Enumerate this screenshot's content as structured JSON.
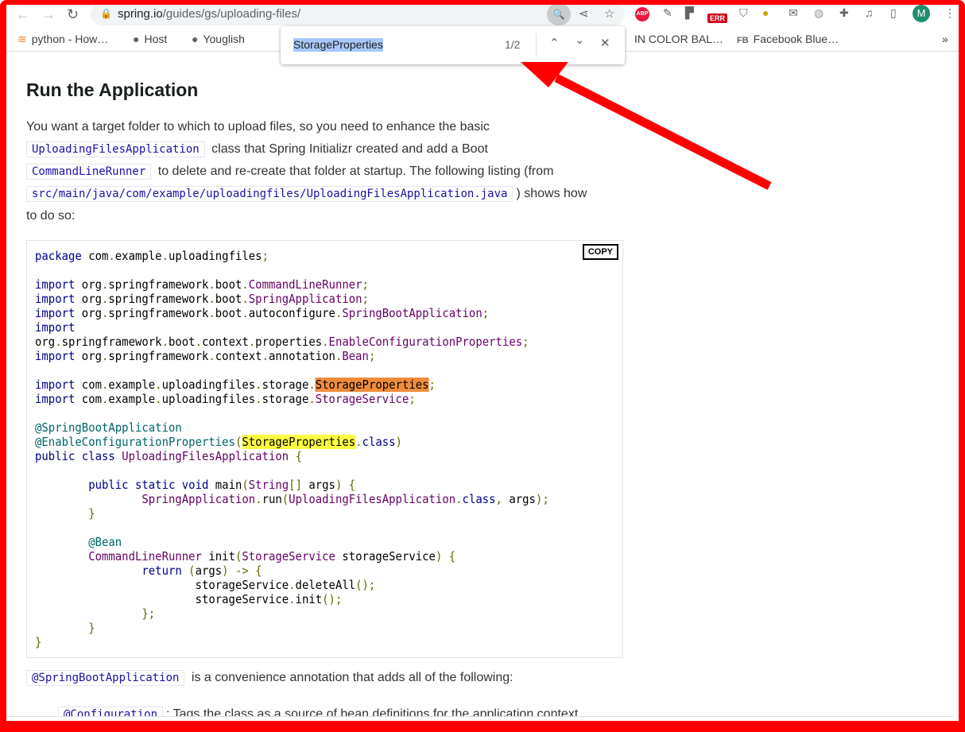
{
  "browser": {
    "url_domain": "spring.io",
    "url_path": "/guides/gs/uploading-files/",
    "profile_initial": "M",
    "extensions": {
      "abp": "ABP",
      "err": "ERR"
    },
    "bookmarks": [
      "python - How…",
      "Host",
      "Youglish",
      "IN COLOR BAL…",
      "Facebook Blue…"
    ],
    "fb_badge": "FB",
    "more": "»"
  },
  "findbar": {
    "query": "StorageProperties",
    "count": "1/2"
  },
  "page": {
    "heading": "Run the Application",
    "para_lines": [
      [
        {
          "t": "You want a target folder to which to upload files, so you need to enhance the basic"
        }
      ],
      [
        {
          "c": "UploadingFilesApplication"
        },
        {
          "t": " class that Spring Initializr created and add a Boot"
        }
      ],
      [
        {
          "c": "CommandLineRunner"
        },
        {
          "t": " to delete and re-create that folder at startup. The following listing (from"
        }
      ],
      [
        {
          "c": "src/main/java/com/example/uploadingfiles/UploadingFilesApplication.java"
        },
        {
          "t": ") shows how"
        }
      ],
      [
        {
          "t": "to do so:"
        }
      ]
    ],
    "copy_label": "COPY",
    "after_code": "@SpringBootApplication",
    "after_text": " is a convenience annotation that adds all of the following:",
    "list_code": "@Configuration",
    "list_text": ": Tags the class as a source of bean definitions for the application context."
  },
  "code": [
    [
      [
        "k",
        "package"
      ],
      [
        "x",
        " com"
      ],
      [
        "p",
        "."
      ],
      [
        "x",
        "example"
      ],
      [
        "p",
        "."
      ],
      [
        "x",
        "uploadingfiles"
      ],
      [
        "p",
        ";"
      ]
    ],
    [],
    [
      [
        "k",
        "import"
      ],
      [
        "x",
        " org"
      ],
      [
        "p",
        "."
      ],
      [
        "x",
        "springframework"
      ],
      [
        "p",
        "."
      ],
      [
        "x",
        "boot"
      ],
      [
        "p",
        "."
      ],
      [
        "t",
        "CommandLineRunner"
      ],
      [
        "p",
        ";"
      ]
    ],
    [
      [
        "k",
        "import"
      ],
      [
        "x",
        " org"
      ],
      [
        "p",
        "."
      ],
      [
        "x",
        "springframework"
      ],
      [
        "p",
        "."
      ],
      [
        "x",
        "boot"
      ],
      [
        "p",
        "."
      ],
      [
        "t",
        "SpringApplication"
      ],
      [
        "p",
        ";"
      ]
    ],
    [
      [
        "k",
        "import"
      ],
      [
        "x",
        " org"
      ],
      [
        "p",
        "."
      ],
      [
        "x",
        "springframework"
      ],
      [
        "p",
        "."
      ],
      [
        "x",
        "boot"
      ],
      [
        "p",
        "."
      ],
      [
        "x",
        "autoconfigure"
      ],
      [
        "p",
        "."
      ],
      [
        "t",
        "SpringBootApplication"
      ],
      [
        "p",
        ";"
      ]
    ],
    [
      [
        "k",
        "import"
      ]
    ],
    [
      [
        "x",
        "org"
      ],
      [
        "p",
        "."
      ],
      [
        "x",
        "springframework"
      ],
      [
        "p",
        "."
      ],
      [
        "x",
        "boot"
      ],
      [
        "p",
        "."
      ],
      [
        "x",
        "context"
      ],
      [
        "p",
        "."
      ],
      [
        "x",
        "properties"
      ],
      [
        "p",
        "."
      ],
      [
        "t",
        "EnableConfigurationProperties"
      ],
      [
        "p",
        ";"
      ]
    ],
    [
      [
        "k",
        "import"
      ],
      [
        "x",
        " org"
      ],
      [
        "p",
        "."
      ],
      [
        "x",
        "springframework"
      ],
      [
        "p",
        "."
      ],
      [
        "x",
        "context"
      ],
      [
        "p",
        "."
      ],
      [
        "x",
        "annotation"
      ],
      [
        "p",
        "."
      ],
      [
        "t",
        "Bean"
      ],
      [
        "p",
        ";"
      ]
    ],
    [],
    [
      [
        "k",
        "import"
      ],
      [
        "x",
        " com"
      ],
      [
        "p",
        "."
      ],
      [
        "x",
        "example"
      ],
      [
        "p",
        "."
      ],
      [
        "x",
        "uploadingfiles"
      ],
      [
        "p",
        "."
      ],
      [
        "x",
        "storage"
      ],
      [
        "p",
        "."
      ],
      [
        "h1",
        "StorageProperties"
      ],
      [
        "p",
        ";"
      ]
    ],
    [
      [
        "k",
        "import"
      ],
      [
        "x",
        " com"
      ],
      [
        "p",
        "."
      ],
      [
        "x",
        "example"
      ],
      [
        "p",
        "."
      ],
      [
        "x",
        "uploadingfiles"
      ],
      [
        "p",
        "."
      ],
      [
        "x",
        "storage"
      ],
      [
        "p",
        "."
      ],
      [
        "t",
        "StorageService"
      ],
      [
        "p",
        ";"
      ]
    ],
    [],
    [
      [
        "a",
        "@SpringBootApplication"
      ]
    ],
    [
      [
        "a",
        "@EnableConfigurationProperties"
      ],
      [
        "p",
        "("
      ],
      [
        "h2",
        "StorageProperties"
      ],
      [
        "p",
        "."
      ],
      [
        "k",
        "class"
      ],
      [
        "p",
        ")"
      ]
    ],
    [
      [
        "k",
        "public"
      ],
      [
        "x",
        " "
      ],
      [
        "k",
        "class"
      ],
      [
        "x",
        " "
      ],
      [
        "t",
        "UploadingFilesApplication"
      ],
      [
        "x",
        " "
      ],
      [
        "p",
        "{"
      ]
    ],
    [],
    [
      [
        "x",
        "        "
      ],
      [
        "k",
        "public"
      ],
      [
        "x",
        " "
      ],
      [
        "k",
        "static"
      ],
      [
        "x",
        " "
      ],
      [
        "k",
        "void"
      ],
      [
        "x",
        " main"
      ],
      [
        "p",
        "("
      ],
      [
        "t",
        "String"
      ],
      [
        "p",
        "[]"
      ],
      [
        "x",
        " args"
      ],
      [
        "p",
        ")"
      ],
      [
        "x",
        " "
      ],
      [
        "p",
        "{"
      ]
    ],
    [
      [
        "x",
        "                "
      ],
      [
        "t",
        "SpringApplication"
      ],
      [
        "p",
        "."
      ],
      [
        "x",
        "run"
      ],
      [
        "p",
        "("
      ],
      [
        "t",
        "UploadingFilesApplication"
      ],
      [
        "p",
        "."
      ],
      [
        "k",
        "class"
      ],
      [
        "p",
        ","
      ],
      [
        "x",
        " args"
      ],
      [
        "p",
        ");"
      ]
    ],
    [
      [
        "x",
        "        "
      ],
      [
        "p",
        "}"
      ]
    ],
    [],
    [
      [
        "x",
        "        "
      ],
      [
        "a",
        "@Bean"
      ]
    ],
    [
      [
        "x",
        "        "
      ],
      [
        "t",
        "CommandLineRunner"
      ],
      [
        "x",
        " init"
      ],
      [
        "p",
        "("
      ],
      [
        "t",
        "StorageService"
      ],
      [
        "x",
        " storageService"
      ],
      [
        "p",
        ")"
      ],
      [
        "x",
        " "
      ],
      [
        "p",
        "{"
      ]
    ],
    [
      [
        "x",
        "                "
      ],
      [
        "k",
        "return"
      ],
      [
        "x",
        " "
      ],
      [
        "p",
        "("
      ],
      [
        "x",
        "args"
      ],
      [
        "p",
        ")"
      ],
      [
        "x",
        " "
      ],
      [
        "p",
        "->"
      ],
      [
        "x",
        " "
      ],
      [
        "p",
        "{"
      ]
    ],
    [
      [
        "x",
        "                        storageService"
      ],
      [
        "p",
        "."
      ],
      [
        "x",
        "deleteAll"
      ],
      [
        "p",
        "();"
      ]
    ],
    [
      [
        "x",
        "                        storageService"
      ],
      [
        "p",
        "."
      ],
      [
        "x",
        "init"
      ],
      [
        "p",
        "();"
      ]
    ],
    [
      [
        "x",
        "                "
      ],
      [
        "p",
        "};"
      ]
    ],
    [
      [
        "x",
        "        "
      ],
      [
        "p",
        "}"
      ]
    ],
    [
      [
        "p",
        "}"
      ]
    ]
  ],
  "annotation_color": "#ff0000"
}
